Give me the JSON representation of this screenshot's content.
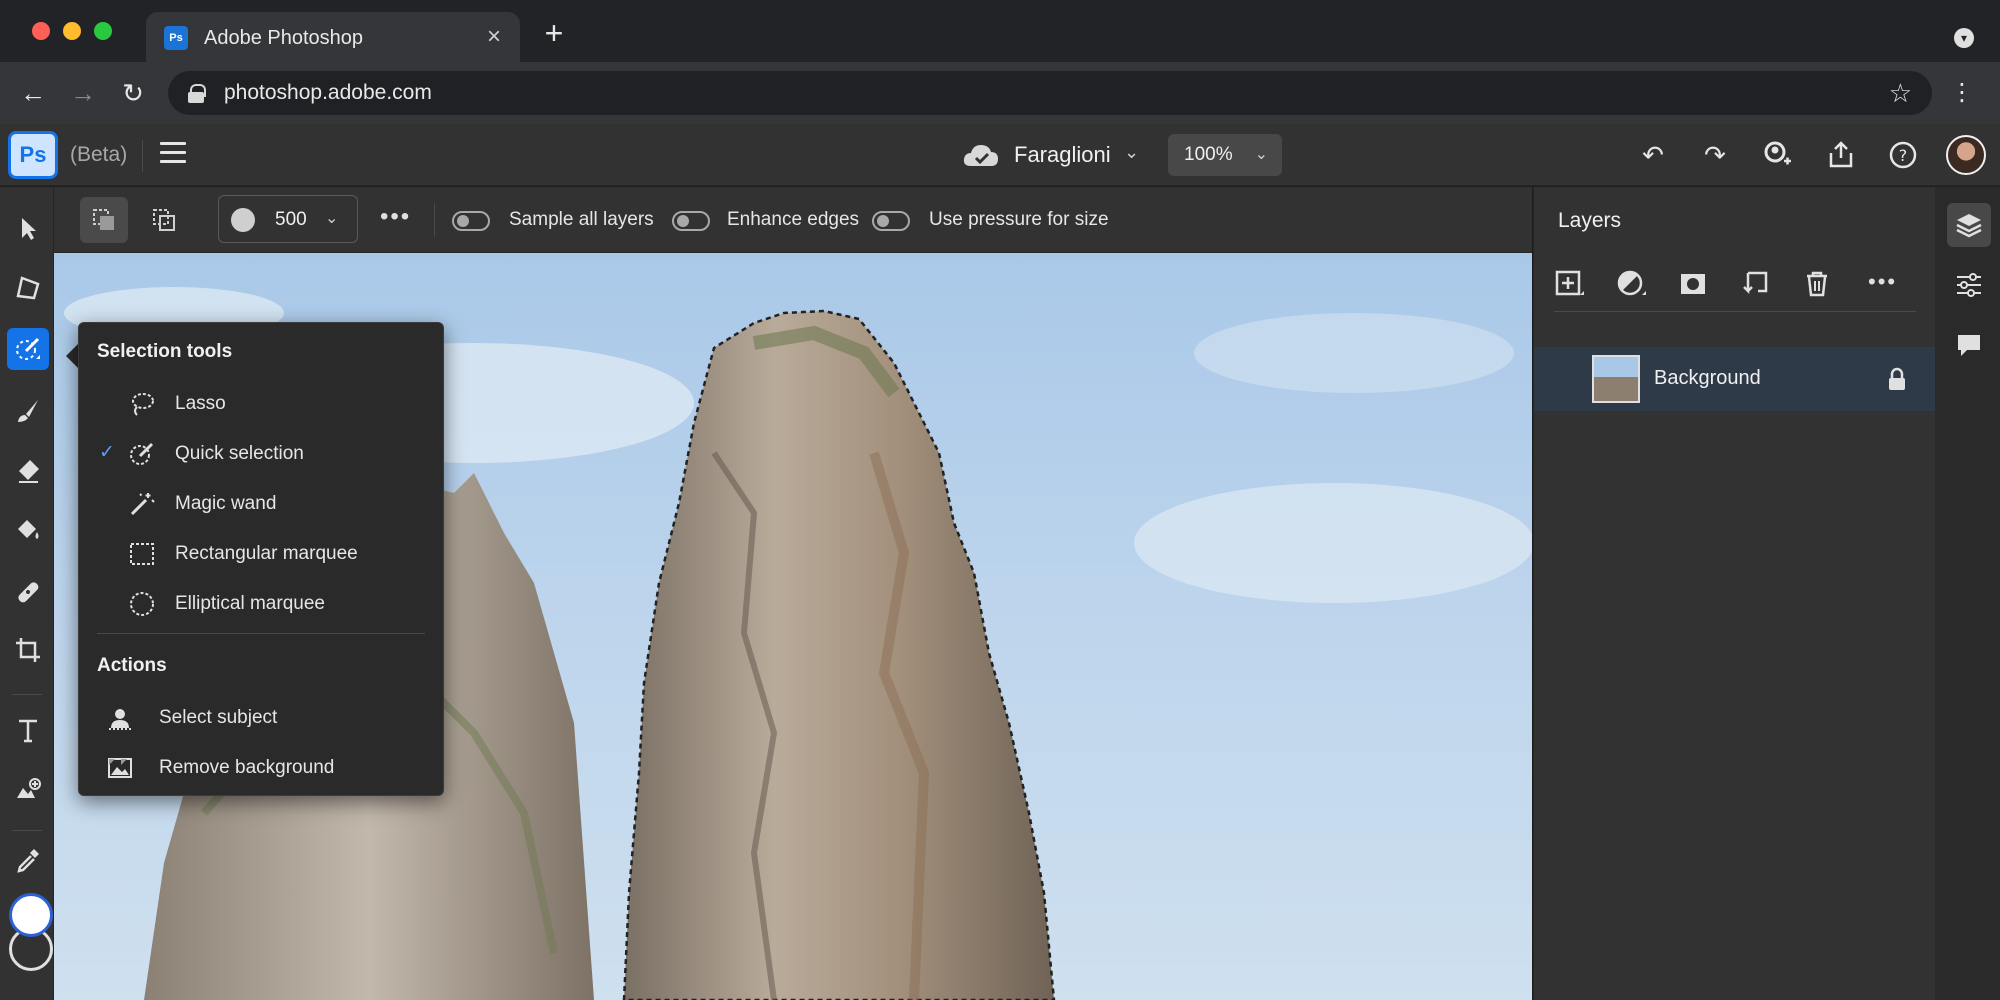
{
  "browser": {
    "tab_title": "Adobe Photoshop",
    "tab_favicon": "Ps",
    "tab_close": "×",
    "new_tab": "+",
    "url": "photoshop.adobe.com"
  },
  "app": {
    "logo": "Ps",
    "beta_label": "(Beta)",
    "document_name": "Faraglioni",
    "zoom": "100%"
  },
  "options_bar": {
    "brush_size": "500",
    "toggles": [
      {
        "label": "Sample all layers"
      },
      {
        "label": "Enhance edges"
      },
      {
        "label": "Use pressure for size"
      }
    ]
  },
  "flyout": {
    "selection_heading": "Selection tools",
    "tools": [
      {
        "label": "Lasso",
        "icon": "lasso-icon",
        "checked": false
      },
      {
        "label": "Quick selection",
        "icon": "quick-selection-icon",
        "checked": true
      },
      {
        "label": "Magic wand",
        "icon": "magic-wand-icon",
        "checked": false
      },
      {
        "label": "Rectangular marquee",
        "icon": "rectangular-marquee-icon",
        "checked": false
      },
      {
        "label": "Elliptical marquee",
        "icon": "elliptical-marquee-icon",
        "checked": false
      }
    ],
    "actions_heading": "Actions",
    "actions": [
      {
        "label": "Select subject",
        "icon": "select-subject-icon"
      },
      {
        "label": "Remove background",
        "icon": "remove-background-icon"
      }
    ]
  },
  "layers_panel": {
    "title": "Layers",
    "layers": [
      {
        "name": "Background",
        "locked": true
      }
    ]
  },
  "colors": {
    "accent": "#1473e6",
    "selected_layer_bg": "#2f3a49",
    "panel_bg": "#323232"
  }
}
